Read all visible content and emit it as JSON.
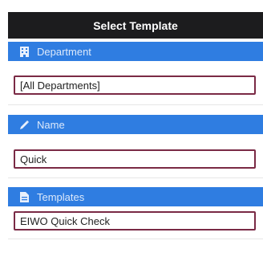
{
  "dialog": {
    "title": "Select Template"
  },
  "sections": [
    {
      "label": "Department",
      "icon": "building-icon",
      "value": "[All Departments]"
    },
    {
      "label": "Name",
      "icon": "pencil-icon",
      "value": "Quick"
    },
    {
      "label": "Templates",
      "icon": "document-icon",
      "value": "EIWO Quick Check"
    }
  ],
  "colors": {
    "title_bar": "#1c1c1e",
    "section_header": "#2f7de1",
    "field_border": "#7a2a45"
  }
}
